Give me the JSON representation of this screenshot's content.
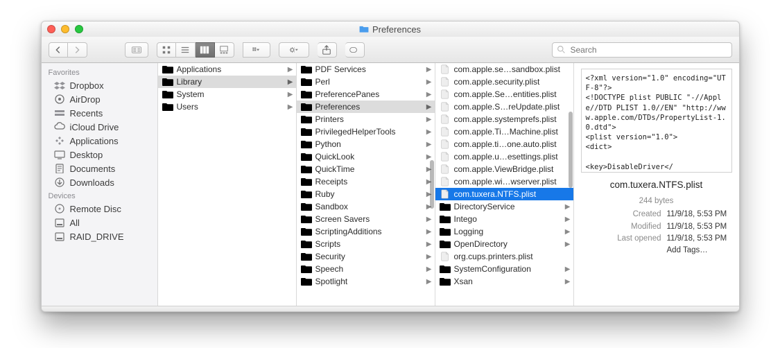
{
  "window": {
    "title": "Preferences"
  },
  "search": {
    "placeholder": "Search"
  },
  "sidebar": {
    "groups": [
      {
        "label": "Favorites",
        "items": [
          {
            "label": "Dropbox",
            "icon": "dropbox"
          },
          {
            "label": "AirDrop",
            "icon": "airdrop"
          },
          {
            "label": "Recents",
            "icon": "recents"
          },
          {
            "label": "iCloud Drive",
            "icon": "icloud"
          },
          {
            "label": "Applications",
            "icon": "apps"
          },
          {
            "label": "Desktop",
            "icon": "desktop"
          },
          {
            "label": "Documents",
            "icon": "docs"
          },
          {
            "label": "Downloads",
            "icon": "downloads"
          }
        ]
      },
      {
        "label": "Devices",
        "items": [
          {
            "label": "Remote Disc",
            "icon": "remote"
          },
          {
            "label": "All",
            "icon": "disk"
          },
          {
            "label": "RAID_DRIVE",
            "icon": "disk"
          }
        ]
      }
    ]
  },
  "columns": [
    {
      "items": [
        {
          "label": "Applications",
          "type": "folder",
          "arrow": true
        },
        {
          "label": "Library",
          "type": "folder",
          "arrow": true,
          "selected": "grey"
        },
        {
          "label": "System",
          "type": "folder",
          "arrow": true
        },
        {
          "label": "Users",
          "type": "folder",
          "arrow": true
        }
      ]
    },
    {
      "items": [
        {
          "label": "PDF Services",
          "type": "folder",
          "arrow": true
        },
        {
          "label": "Perl",
          "type": "folder",
          "arrow": true
        },
        {
          "label": "PreferencePanes",
          "type": "folder",
          "arrow": true
        },
        {
          "label": "Preferences",
          "type": "folder",
          "arrow": true,
          "selected": "grey"
        },
        {
          "label": "Printers",
          "type": "folder",
          "arrow": true
        },
        {
          "label": "PrivilegedHelperTools",
          "type": "folder",
          "arrow": true
        },
        {
          "label": "Python",
          "type": "folder",
          "arrow": true
        },
        {
          "label": "QuickLook",
          "type": "folder",
          "arrow": true
        },
        {
          "label": "QuickTime",
          "type": "folder",
          "arrow": true
        },
        {
          "label": "Receipts",
          "type": "folder",
          "arrow": true
        },
        {
          "label": "Ruby",
          "type": "folder",
          "arrow": true
        },
        {
          "label": "Sandbox",
          "type": "folder",
          "arrow": true
        },
        {
          "label": "Screen Savers",
          "type": "folder",
          "arrow": true
        },
        {
          "label": "ScriptingAdditions",
          "type": "folder",
          "arrow": true
        },
        {
          "label": "Scripts",
          "type": "folder",
          "arrow": true
        },
        {
          "label": "Security",
          "type": "folder",
          "arrow": true
        },
        {
          "label": "Speech",
          "type": "folder",
          "arrow": true
        },
        {
          "label": "Spotlight",
          "type": "folder",
          "arrow": true
        }
      ]
    },
    {
      "items": [
        {
          "label": "com.apple.se…sandbox.plist",
          "type": "file"
        },
        {
          "label": "com.apple.security.plist",
          "type": "file"
        },
        {
          "label": "com.apple.Se…entities.plist",
          "type": "file"
        },
        {
          "label": "com.apple.S…reUpdate.plist",
          "type": "file"
        },
        {
          "label": "com.apple.systemprefs.plist",
          "type": "file"
        },
        {
          "label": "com.apple.Ti…Machine.plist",
          "type": "file"
        },
        {
          "label": "com.apple.ti…one.auto.plist",
          "type": "file"
        },
        {
          "label": "com.apple.u…esettings.plist",
          "type": "file"
        },
        {
          "label": "com.apple.ViewBridge.plist",
          "type": "file"
        },
        {
          "label": "com.apple.wi…wserver.plist",
          "type": "file"
        },
        {
          "label": "com.tuxera.NTFS.plist",
          "type": "file",
          "selected": "blue"
        },
        {
          "label": "DirectoryService",
          "type": "folder",
          "arrow": true
        },
        {
          "label": "Intego",
          "type": "folder",
          "arrow": true
        },
        {
          "label": "Logging",
          "type": "folder",
          "arrow": true
        },
        {
          "label": "OpenDirectory",
          "type": "folder",
          "arrow": true
        },
        {
          "label": "org.cups.printers.plist",
          "type": "file"
        },
        {
          "label": "SystemConfiguration",
          "type": "folder",
          "arrow": true
        },
        {
          "label": "Xsan",
          "type": "folder",
          "arrow": true
        }
      ]
    }
  ],
  "preview": {
    "xml": "<?xml version=\"1.0\" encoding=\"UTF-8\"?>\n<!DOCTYPE plist PUBLIC \"-//Apple//DTD PLIST 1.0//EN\" \"http://www.apple.com/DTDs/PropertyList-1.0.dtd\">\n<plist version=\"1.0\">\n<dict>\n\n<key>DisableDriver</",
    "title": "com.tuxera.NTFS.plist",
    "size": "244 bytes",
    "created_label": "Created",
    "created": "11/9/18, 5:53 PM",
    "modified_label": "Modified",
    "modified": "11/9/18, 5:53 PM",
    "opened_label": "Last opened",
    "opened": "11/9/18, 5:53 PM",
    "addtags": "Add Tags…"
  }
}
